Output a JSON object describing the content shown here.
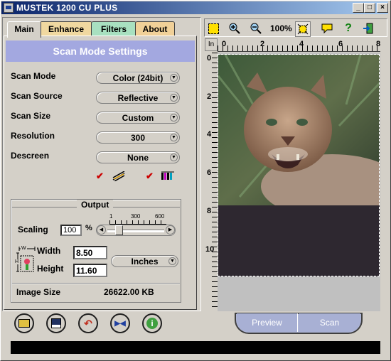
{
  "window": {
    "title": "MUSTEK 1200 CU PLUS",
    "min": "_",
    "max": "□",
    "close": "×"
  },
  "tabs": [
    {
      "label": "Main",
      "active": true,
      "color": "#d4d0c8"
    },
    {
      "label": "Enhance",
      "color": "#f0d8a0"
    },
    {
      "label": "Filters",
      "color": "#a8e0c0"
    },
    {
      "label": "About",
      "color": "#f0d098"
    }
  ],
  "banner": "Scan Mode Settings",
  "settings": [
    {
      "label": "Scan Mode",
      "value": "Color (24bit)"
    },
    {
      "label": "Scan Source",
      "value": "Reflective"
    },
    {
      "label": "Scan Size",
      "value": "Custom"
    },
    {
      "label": "Resolution",
      "value": "300"
    },
    {
      "label": "Descreen",
      "value": "None"
    }
  ],
  "output": {
    "title": "Output",
    "scaling_label": "Scaling",
    "scaling_value": "100",
    "scaling_unit": "%",
    "scale_ticks": [
      "1",
      "300",
      "600"
    ],
    "width_label": "Width",
    "width_value": "8.50",
    "height_label": "Height",
    "height_value": "11.60",
    "units": "Inches",
    "image_size_label": "Image Size",
    "image_size_value": "26622.00 KB",
    "dim_w": "W",
    "dim_h": "H"
  },
  "toolbar": {
    "zoom": "100%"
  },
  "ruler": {
    "unit": "In",
    "h_ticks": [
      "0",
      "2",
      "4",
      "6",
      "8"
    ],
    "v_ticks": [
      "0",
      "2",
      "4",
      "6",
      "8",
      "10"
    ]
  },
  "buttons": {
    "preview": "Preview",
    "scan": "Scan"
  },
  "colors": {
    "accent": "#a3a8e0",
    "title_start": "#0a246a",
    "title_end": "#a6caf0"
  }
}
